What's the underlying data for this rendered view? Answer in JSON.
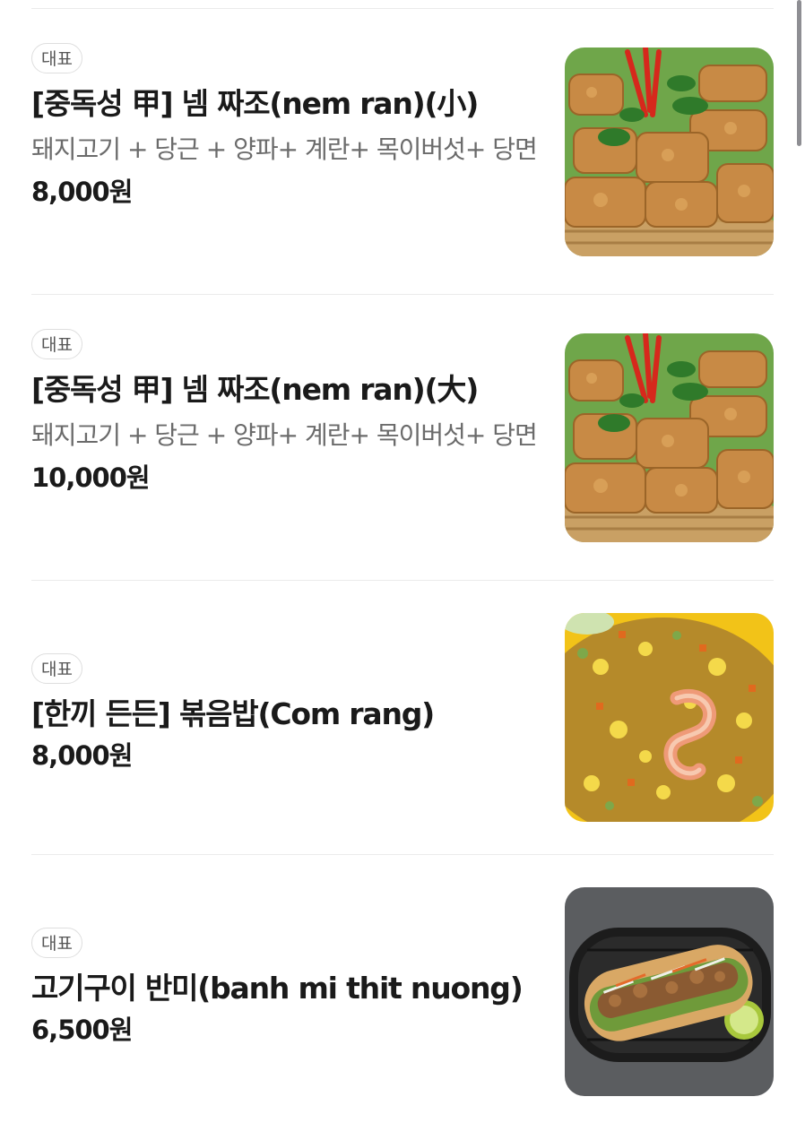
{
  "menu": {
    "items": [
      {
        "badge": "대표",
        "name": "[중독성 甲] 넴 짜조(nem ran)(小)",
        "description": "돼지고기 + 당근 + 양파+ 계란+ 목이버섯+ 당면",
        "price": "8,000원",
        "image_icon": "spring-rolls-photo"
      },
      {
        "badge": "대표",
        "name": "[중독성 甲] 넴 짜조(nem ran)(大)",
        "description": "돼지고기 + 당근 + 양파+ 계란+ 목이버섯+ 당면",
        "price": "10,000원",
        "image_icon": "spring-rolls-photo"
      },
      {
        "badge": "대표",
        "name": "[한끼 든든] 볶음밥(Com rang)",
        "price": "8,000원",
        "image_icon": "fried-rice-photo"
      },
      {
        "badge": "대표",
        "name": "고기구이 반미(banh mi thit nuong)",
        "price": "6,500원",
        "image_icon": "banh-mi-photo"
      }
    ]
  }
}
